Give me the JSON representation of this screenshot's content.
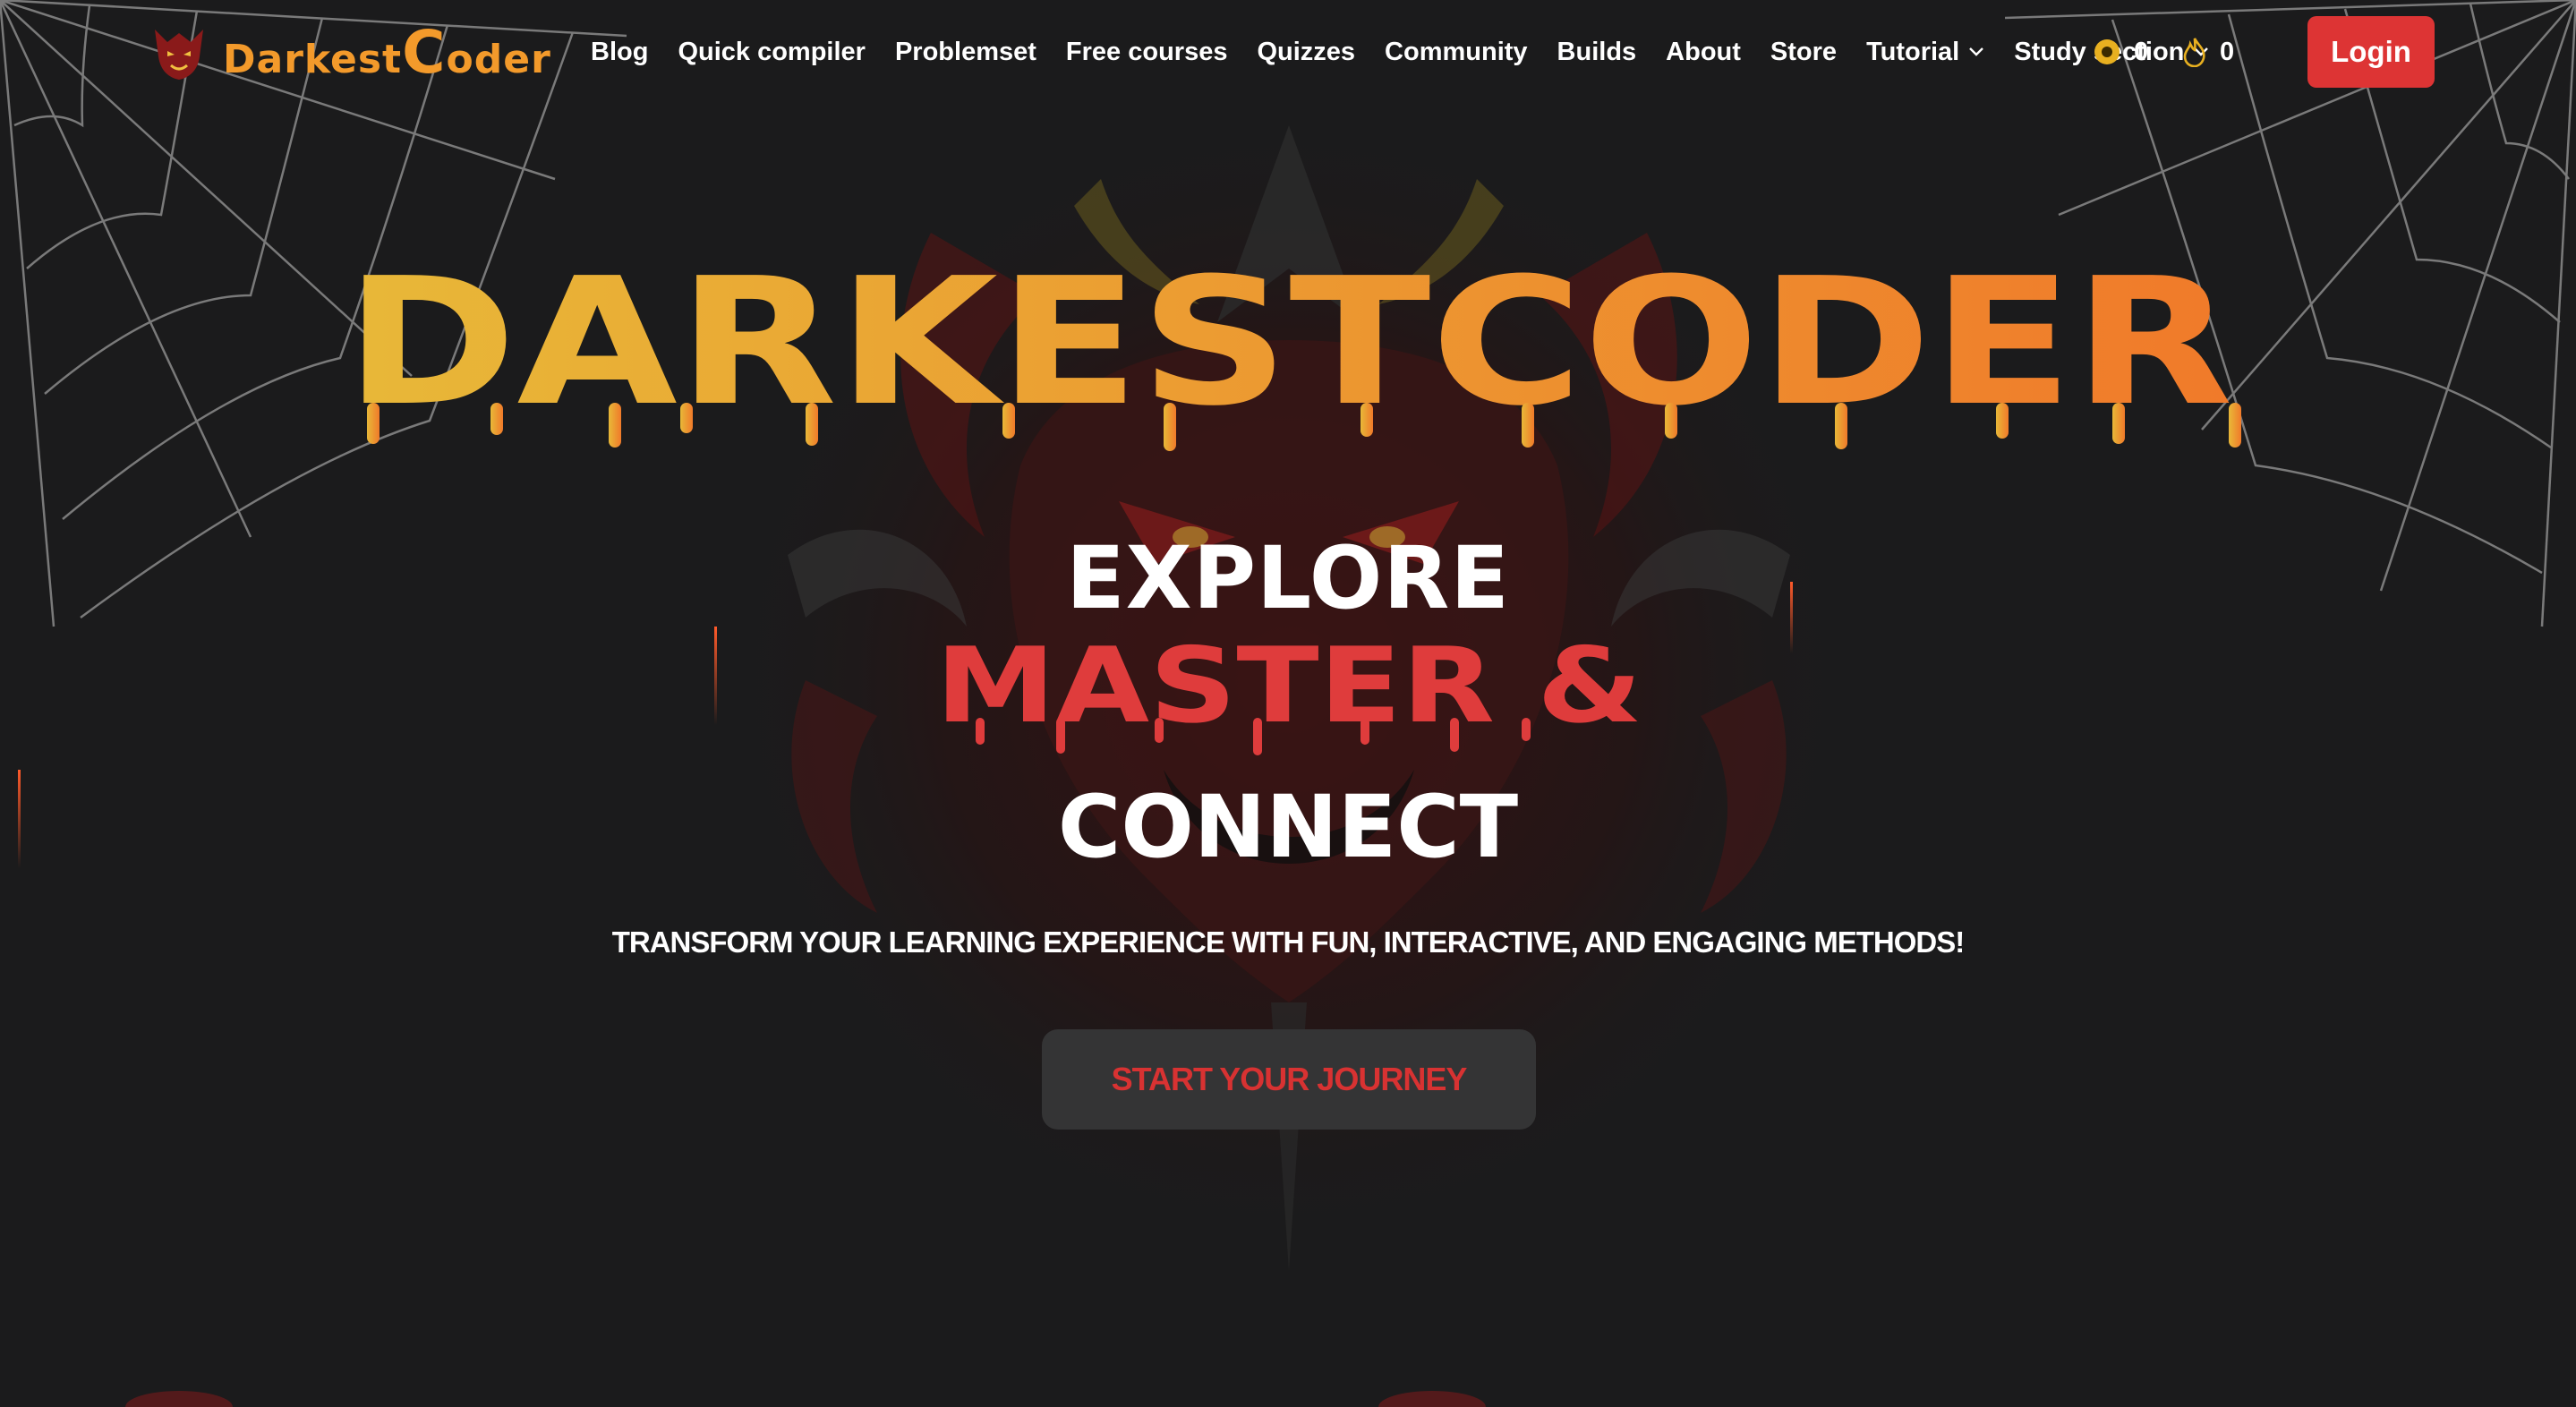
{
  "brand": {
    "logo_text_prefix": "Darkest",
    "logo_text_c": "C",
    "logo_text_suffix": "oder"
  },
  "nav": {
    "items": [
      {
        "label": "Blog"
      },
      {
        "label": "Quick compiler"
      },
      {
        "label": "Problemset"
      },
      {
        "label": "Free courses"
      },
      {
        "label": "Quizzes"
      },
      {
        "label": "Community"
      },
      {
        "label": "Builds"
      },
      {
        "label": "About"
      },
      {
        "label": "Store"
      },
      {
        "label": "Tutorial",
        "dropdown": true
      },
      {
        "label": "Study section",
        "dropdown": true
      }
    ],
    "coins": "0",
    "streak": "0",
    "login_label": "Login"
  },
  "hero": {
    "title": "DARKESTCODER",
    "line1": "EXPLORE",
    "line2": "MASTER &",
    "line3": "CONNECT",
    "tagline": "TRANSFORM YOUR LEARNING EXPERIENCE WITH FUN, INTERACTIVE, AND ENGAGING METHODS!",
    "cta_label": "START YOUR JOURNEY"
  },
  "colors": {
    "background": "#1b1b1c",
    "accent_red": "#dd3434",
    "accent_orange": "#f39a2b",
    "title_gradient_start": "#e8b838",
    "title_gradient_end": "#f07a2a",
    "cta_background": "#343435"
  },
  "icons": {
    "coin": "coin-icon",
    "streak": "flame-icon",
    "dropdown": "chevron-down-icon",
    "logo": "demon-logo-icon"
  }
}
